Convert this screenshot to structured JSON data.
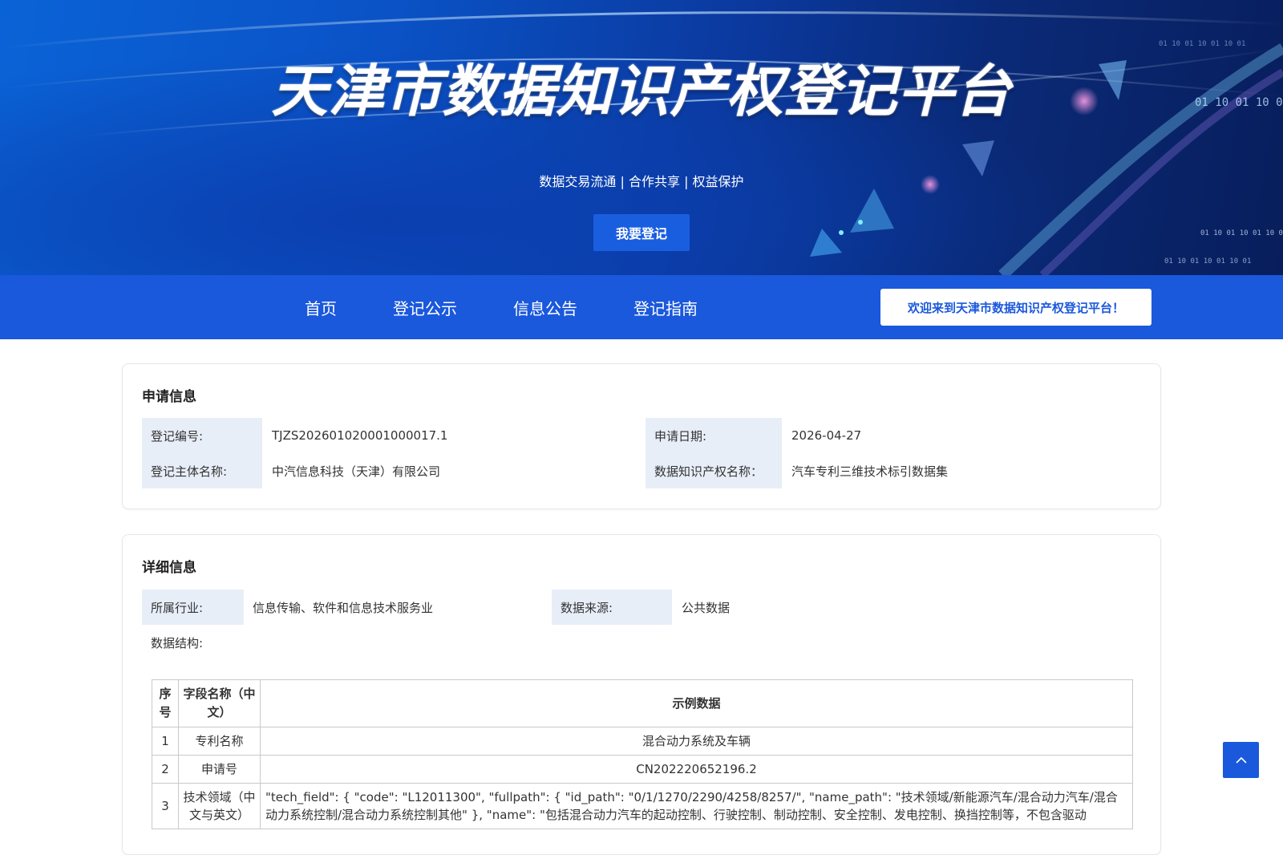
{
  "banner": {
    "title": "天津市数据知识产权登记平台",
    "subtitle": "数据交易流通 | 合作共享 | 权益保护",
    "register_button": "我要登记",
    "binary_text": "01 10 01 10 01 10 01"
  },
  "nav": {
    "items": [
      "首页",
      "登记公示",
      "信息公告",
      "登记指南"
    ],
    "welcome": "欢迎来到天津市数据知识产权登记平台！"
  },
  "application": {
    "title": "申请信息",
    "reg_no_label": "登记编号:",
    "reg_no": "TJZS202601020001000017.1",
    "date_label": "申请日期:",
    "date": "2026-04-27",
    "subject_label": "登记主体名称:",
    "subject": "中汽信息科技（天津）有限公司",
    "ip_name_label": "数据知识产权名称：",
    "ip_name": "汽车专利三维技术标引数据集"
  },
  "details": {
    "title": "详细信息",
    "industry_label": "所属行业:",
    "industry": "信息传输、软件和信息技术服务业",
    "source_label": "数据来源:",
    "source": "公共数据",
    "structure_label": "数据结构:",
    "table": {
      "headers": [
        "序号",
        "字段名称（中文）",
        "示例数据"
      ],
      "rows": [
        [
          "1",
          "专利名称",
          "混合动力系统及车辆"
        ],
        [
          "2",
          "申请号",
          "CN202220652196.2"
        ],
        [
          "3",
          "技术领域（中文与英文）",
          "\"tech_field\": { \"code\": \"L12011300\", \"fullpath\": { \"id_path\": \"0/1/1270/2290/4258/8257/\", \"name_path\": \"技术领域/新能源汽车/混合动力汽车/混合动力系统控制/混合动力系统控制其他\" }, \"name\": \"包括混合动力汽车的起动控制、行驶控制、制动控制、安全控制、发电控制、换挡控制等，不包含驱动"
        ]
      ]
    }
  },
  "colors": {
    "primary": "#1a58dc",
    "label_bg": "#e8eef8"
  },
  "icons": {
    "back_to_top": "chevron-up-icon"
  }
}
